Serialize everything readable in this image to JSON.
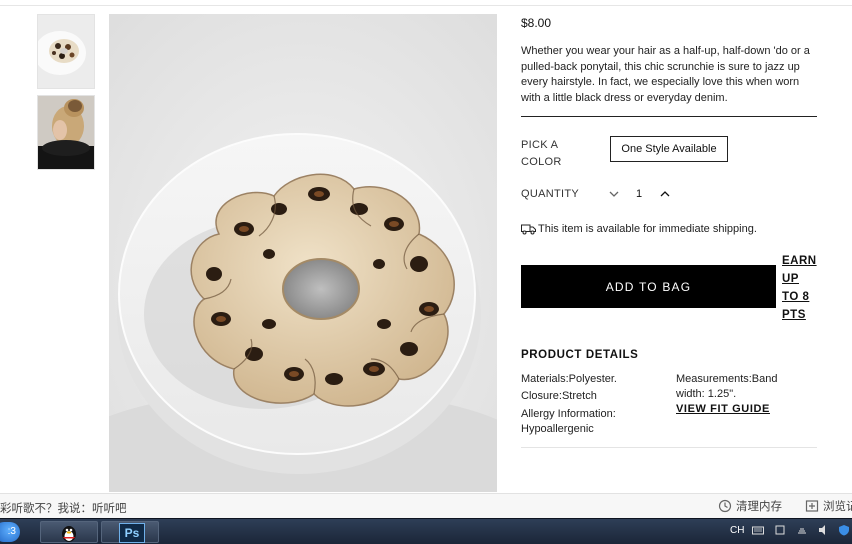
{
  "product": {
    "price": "$8.00",
    "description": "Whether you wear your hair as a half-up, half-down 'do or a pulled-back ponytail, this chic scrunchie is sure to jazz up every hairstyle. In fact, we especially love this when worn with a little black dress or everyday denim.",
    "pick_color_label": "PICK A COLOR",
    "style_option": "One Style Available",
    "quantity_label": "QUANTITY",
    "quantity_value": "1",
    "shipping_text": "This item is available for immediate shipping.",
    "add_to_bag": "ADD TO BAG",
    "earn_lines": [
      "EARN",
      "UP",
      "TO 8",
      "PTS"
    ]
  },
  "details": {
    "title": "PRODUCT DETAILS",
    "materials": "Materials:Polyester.",
    "closure": "Closure:Stretch",
    "allergy": "Allergy Information: Hypoallergenic",
    "measurements": "Measurements:Band width: 1.25\".",
    "fit_guide": "VIEW FIT GUIDE"
  },
  "status_bar": {
    "left_text": "彩听歌不？我说：听听吧",
    "clear_memory": "清理内存",
    "browse_history": "浏览记"
  },
  "taskbar": {
    "ime": "CH",
    "ps_label": "Ps"
  },
  "colors": {
    "button_bg": "#000000",
    "button_text": "#ffffff",
    "taskbar": "#1b2638"
  },
  "icons": [
    "shipping-truck-icon",
    "chevron-down-icon",
    "chevron-up-icon",
    "clear-memory-icon",
    "browse-history-icon",
    "qq-penguin-icon",
    "photoshop-icon",
    "start-orb-icon"
  ]
}
